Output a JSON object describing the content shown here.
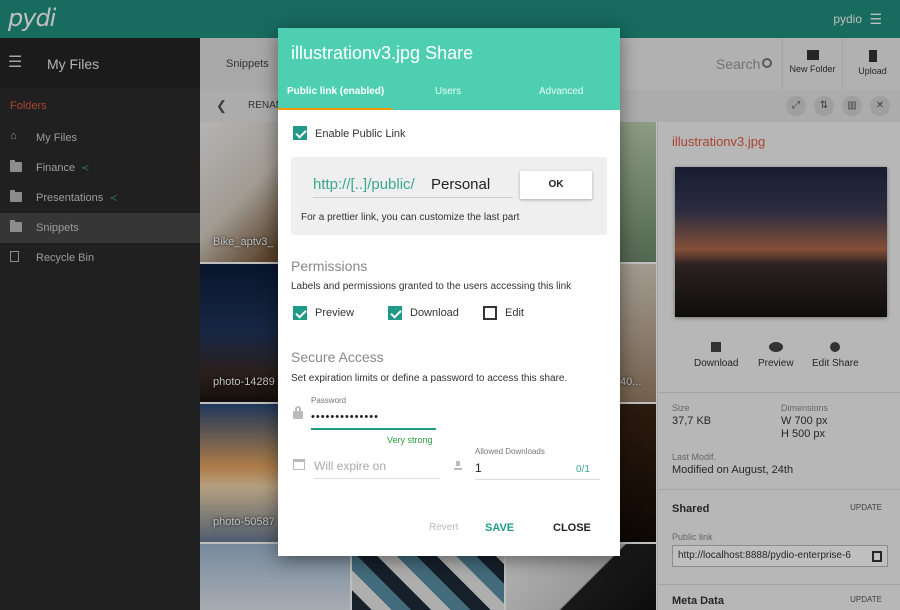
{
  "app": {
    "logo": "pydi",
    "user": "pydio"
  },
  "sidebar": {
    "title": "My Files",
    "folders_title": "Folders",
    "items": [
      {
        "label": "My Files",
        "shared": false
      },
      {
        "label": "Finance",
        "shared": true
      },
      {
        "label": "Presentations",
        "shared": true
      },
      {
        "label": "Snippets",
        "shared": false,
        "active": true
      },
      {
        "label": "Recycle Bin",
        "shared": false
      }
    ]
  },
  "toolbar": {
    "breadcrumb": "Snippets",
    "search_label": "Search",
    "new_folder_label": "New Folder",
    "upload_label": "Upload"
  },
  "pathbar": {
    "label": "RENAM"
  },
  "thumbnails": [
    {
      "label": "Bike_aptv3_"
    },
    {
      "label": "photo-14289"
    },
    {
      "label": "photo-50587"
    },
    {
      "label": "40..."
    }
  ],
  "info": {
    "title": "illustrationv3.jpg",
    "actions": {
      "download": "Download",
      "preview": "Preview",
      "share": "Edit Share"
    },
    "size_label": "Size",
    "size_value": "37,7 KB",
    "dimensions_label": "Dimensions",
    "width_value": "W 700 px",
    "height_value": "H 500 px",
    "modif_label": "Last Modif.",
    "modif_value": "Modified on August, 24th",
    "shared_title": "Shared",
    "update_label": "UPDATE",
    "public_link_label": "Public link",
    "public_link_value": "http://localhost:8888/pydio-enterprise-6",
    "meta_title": "Meta Data"
  },
  "modal": {
    "title": "illustrationv3.jpg Share",
    "tabs": [
      "Public link (enabled)",
      "Users",
      "Advanced"
    ],
    "enable_label": "Enable Public Link",
    "link_prefix": "http://[..]/public/",
    "link_slug": "Personal",
    "ok_label": "OK",
    "link_hint": "For a prettier link, you can customize the last part",
    "permissions_title": "Permissions",
    "permissions_desc": "Labels and permissions granted to the users accessing this link",
    "perm_preview": "Preview",
    "perm_download": "Download",
    "perm_edit": "Edit",
    "secure_title": "Secure Access",
    "secure_desc": "Set expiration limits or define a password to access this share.",
    "password_label": "Password",
    "password_value": "••••••••••••••",
    "strength_label": "Very strong",
    "expire_placeholder": "Will expire on",
    "allowed_label": "Allowed Downloads",
    "allowed_value": "1",
    "allowed_count": "0/1",
    "revert_label": "Revert",
    "save_label": "SAVE",
    "close_label": "CLOSE"
  },
  "colors": {
    "brand": "#1f8f7f",
    "modal_header": "#4ecfb2",
    "accent": "#e35b42",
    "check": "#1f9a86",
    "tab_ink": "#ff9800"
  }
}
